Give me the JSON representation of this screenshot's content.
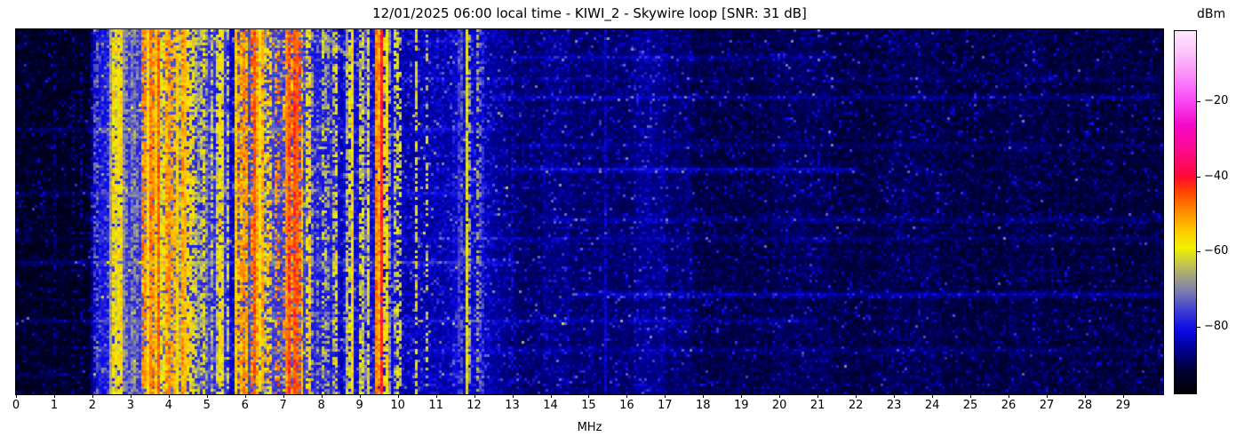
{
  "header": {
    "title": "12/01/2025 06:00 local time - KIWI_2 - Skywire loop [SNR: 31 dB]",
    "datetime": "12/01/2025 06:00 local time",
    "station": "KIWI_2",
    "antenna": "Skywire loop",
    "snr_label": "SNR: 31 dB",
    "snr_db": 31
  },
  "chart_data": {
    "type": "heatmap",
    "subtype": "radio-spectrogram-waterfall",
    "title": "12/01/2025 06:00 local time - KIWI_2 - Skywire loop [SNR: 31 dB]",
    "xlabel": "MHz",
    "x_range": [
      0,
      30.05
    ],
    "x_ticks": [
      0,
      1,
      2,
      3,
      4,
      5,
      6,
      7,
      8,
      9,
      10,
      11,
      12,
      13,
      14,
      15,
      16,
      17,
      18,
      19,
      20,
      21,
      22,
      23,
      24,
      25,
      26,
      27,
      28,
      29
    ],
    "grid": false,
    "legend": "none",
    "colorbar": {
      "label": "dBm",
      "vmin": -98,
      "vmax": -1,
      "ticks": [
        -20,
        -40,
        -60,
        -80
      ],
      "tick_labels": [
        "−20",
        "−40",
        "−60",
        "−80"
      ],
      "position": "right"
    },
    "colormap_stops": [
      [
        -98,
        "#000000"
      ],
      [
        -92,
        "#000032"
      ],
      [
        -86,
        "#000096"
      ],
      [
        -81,
        "#0a0ae6"
      ],
      [
        -76,
        "#3c3cd2"
      ],
      [
        -71,
        "#7878b4"
      ],
      [
        -67,
        "#a0a082"
      ],
      [
        -63,
        "#c8c848"
      ],
      [
        -59,
        "#f2f200"
      ],
      [
        -54,
        "#ffc400"
      ],
      [
        -49,
        "#ff8800"
      ],
      [
        -44,
        "#ff4400"
      ],
      [
        -40,
        "#ff0a32"
      ],
      [
        -33,
        "#fa0a8c"
      ],
      [
        -26,
        "#f50ac8"
      ],
      [
        -20,
        "#f846f5"
      ],
      [
        -12,
        "#fb96fa"
      ],
      [
        -6,
        "#fdc8fc"
      ],
      [
        -1,
        "#ffeaff"
      ]
    ],
    "background_format": "[fStartMHz, fEndMHz, levelStartDbm, levelEndDbm]",
    "background": [
      [
        0.0,
        1.9,
        -95.5,
        -95.5
      ],
      [
        1.9,
        2.2,
        -95.5,
        -85.0
      ],
      [
        2.2,
        8.5,
        -85.0,
        -85.0
      ],
      [
        8.5,
        12.4,
        -86.5,
        -86.5
      ],
      [
        12.4,
        13.2,
        -86.5,
        -90.5
      ],
      [
        13.2,
        17.0,
        -90.5,
        -90.5
      ],
      [
        17.0,
        30.1,
        -92.5,
        -93.5
      ]
    ],
    "bands_format": "[fStartMHz, fEndMHz, bgBoostDb, stripesPerMHz, levelMinDbm, levelMaxDbm, duty]",
    "bands": [
      [
        1.95,
        2.45,
        3,
        7,
        -76,
        -66,
        0.45
      ],
      [
        2.45,
        2.85,
        6,
        22,
        -70,
        -55,
        0.8
      ],
      [
        2.85,
        3.25,
        6,
        10,
        -74,
        -62,
        0.6
      ],
      [
        3.25,
        3.8,
        9,
        42,
        -62,
        -46,
        0.9
      ],
      [
        3.8,
        4.45,
        9,
        38,
        -64,
        -50,
        0.85
      ],
      [
        4.45,
        5.15,
        6,
        16,
        -72,
        -57,
        0.7
      ],
      [
        5.15,
        5.6,
        5,
        12,
        -70,
        -58,
        0.7
      ],
      [
        5.75,
        6.45,
        8,
        32,
        -64,
        -48,
        0.85
      ],
      [
        6.45,
        7.02,
        7,
        18,
        -68,
        -52,
        0.6
      ],
      [
        7.02,
        7.5,
        9,
        38,
        -60,
        -44,
        0.9
      ],
      [
        7.5,
        7.7,
        7,
        20,
        -66,
        -54,
        0.7
      ],
      [
        7.7,
        8.45,
        4,
        9,
        -74,
        -60,
        0.5
      ],
      [
        8.6,
        10.05,
        3,
        11,
        -74,
        -58,
        0.65
      ],
      [
        11.45,
        12.3,
        2,
        7,
        -78,
        -66,
        0.55
      ]
    ],
    "carriers_format": "[fMHz, levelDbm, widthCells, flickerDb, duty]",
    "carriers": [
      [
        0.98,
        -86,
        1,
        2,
        0.25
      ],
      [
        1.45,
        -85,
        1,
        2,
        0.2
      ],
      [
        1.7,
        -84,
        1,
        2,
        0.25
      ],
      [
        2.65,
        -58,
        1,
        4,
        0.9
      ],
      [
        2.72,
        -56,
        1,
        4,
        0.92
      ],
      [
        5.33,
        -57,
        1,
        4,
        0.9
      ],
      [
        5.4,
        -60,
        1,
        4,
        0.85
      ],
      [
        6.23,
        -45,
        1,
        4,
        0.95
      ],
      [
        6.74,
        -50,
        1,
        5,
        0.4
      ],
      [
        6.86,
        -48,
        1,
        5,
        0.35
      ],
      [
        6.95,
        -52,
        1,
        5,
        0.3
      ],
      [
        7.1,
        -48,
        1,
        5,
        0.95
      ],
      [
        7.25,
        -44,
        2,
        4,
        0.95
      ],
      [
        7.42,
        -47,
        1,
        5,
        0.9
      ],
      [
        8.05,
        -64,
        1,
        5,
        0.5
      ],
      [
        8.4,
        -58,
        1,
        5,
        0.5
      ],
      [
        8.77,
        -56,
        1,
        4,
        0.95
      ],
      [
        9.05,
        -70,
        1,
        4,
        0.4
      ],
      [
        9.4,
        -49,
        2,
        5,
        0.97
      ],
      [
        9.57,
        -41,
        1,
        3,
        0.98
      ],
      [
        9.72,
        -57,
        1,
        4,
        0.9
      ],
      [
        9.9,
        -64,
        1,
        5,
        0.5
      ],
      [
        10.45,
        -58,
        1,
        6,
        0.6
      ],
      [
        10.72,
        -64,
        1,
        5,
        0.35
      ],
      [
        11.57,
        -76,
        1,
        3,
        0.7
      ],
      [
        11.64,
        -74,
        1,
        3,
        0.6
      ],
      [
        11.78,
        -60,
        1,
        4,
        0.95
      ],
      [
        12.09,
        -71,
        1,
        3,
        0.9
      ],
      [
        13.0,
        -82,
        1,
        2,
        0.5
      ],
      [
        15.42,
        -83,
        1,
        2,
        0.8
      ],
      [
        17.55,
        -86,
        1,
        2,
        0.5
      ]
    ],
    "soft_columns_format": "[fStartMHz, fEndMHz, boostDb]",
    "soft_columns": [
      [
        13.8,
        14.5,
        1.5
      ],
      [
        16.2,
        17.7,
        2.0
      ],
      [
        19.8,
        21.3,
        1.2
      ],
      [
        22.8,
        24.2,
        1.0
      ],
      [
        26.0,
        27.0,
        0.8
      ]
    ],
    "streaks_format": "[rowFracFromTop, fStartMHz, fEndMHz, ampDb]",
    "streaks": [
      [
        0.03,
        2.0,
        12.0,
        3.0
      ],
      [
        0.07,
        13.0,
        21.5,
        5.0
      ],
      [
        0.13,
        0.0,
        30.0,
        2.5
      ],
      [
        0.185,
        12.5,
        30.0,
        4.5
      ],
      [
        0.27,
        0.0,
        12.5,
        4.0
      ],
      [
        0.315,
        13.0,
        30.0,
        3.0
      ],
      [
        0.38,
        13.0,
        22.0,
        6.0
      ],
      [
        0.45,
        0.0,
        12.5,
        4.0
      ],
      [
        0.52,
        14.0,
        30.0,
        3.5
      ],
      [
        0.575,
        0.0,
        30.0,
        2.5
      ],
      [
        0.64,
        0.0,
        13.0,
        5.0
      ],
      [
        0.73,
        14.5,
        30.0,
        6.0
      ],
      [
        0.8,
        0.0,
        21.0,
        4.0
      ],
      [
        0.88,
        2.0,
        30.0,
        3.0
      ],
      [
        0.95,
        0.0,
        12.0,
        3.0
      ]
    ],
    "chirp": {
      "f0": 8.1,
      "f1": 9.0,
      "row0": 0.01,
      "row1": 0.1,
      "level": -69
    },
    "seed": 20251201
  }
}
